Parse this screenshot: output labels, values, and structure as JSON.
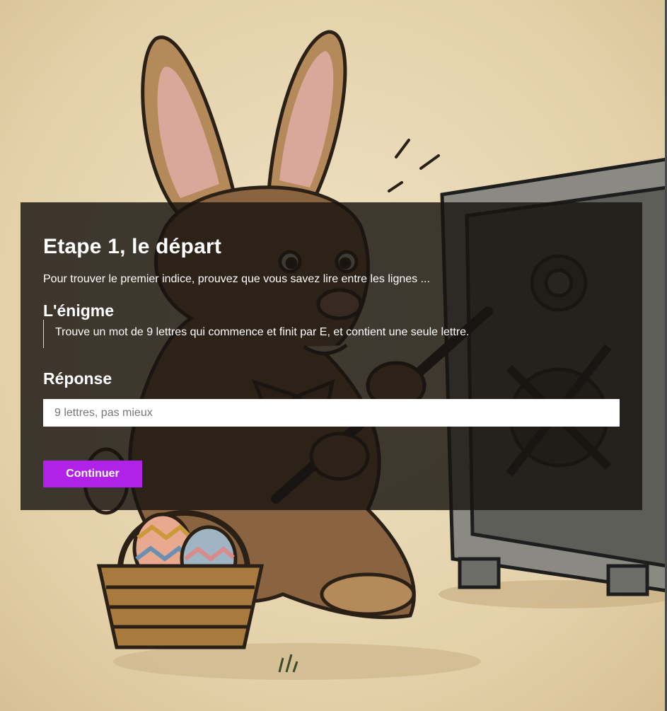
{
  "step": {
    "title": "Etape 1, le départ",
    "subtitle": "Pour trouver le premier indice, prouvez que vous savez lire entre les lignes ..."
  },
  "enigma": {
    "heading": "L'énigme",
    "text": "Trouve un mot de 9 lettres qui commence et finit par E, et contient une seule lettre."
  },
  "answer": {
    "heading": "Réponse",
    "placeholder": "9 lettres, pas mieux",
    "value": ""
  },
  "actions": {
    "continue_label": "Continuer"
  },
  "colors": {
    "accent": "#b022e8",
    "background": "#e6d5b2",
    "card": "rgba(24,20,16,0.82)"
  }
}
